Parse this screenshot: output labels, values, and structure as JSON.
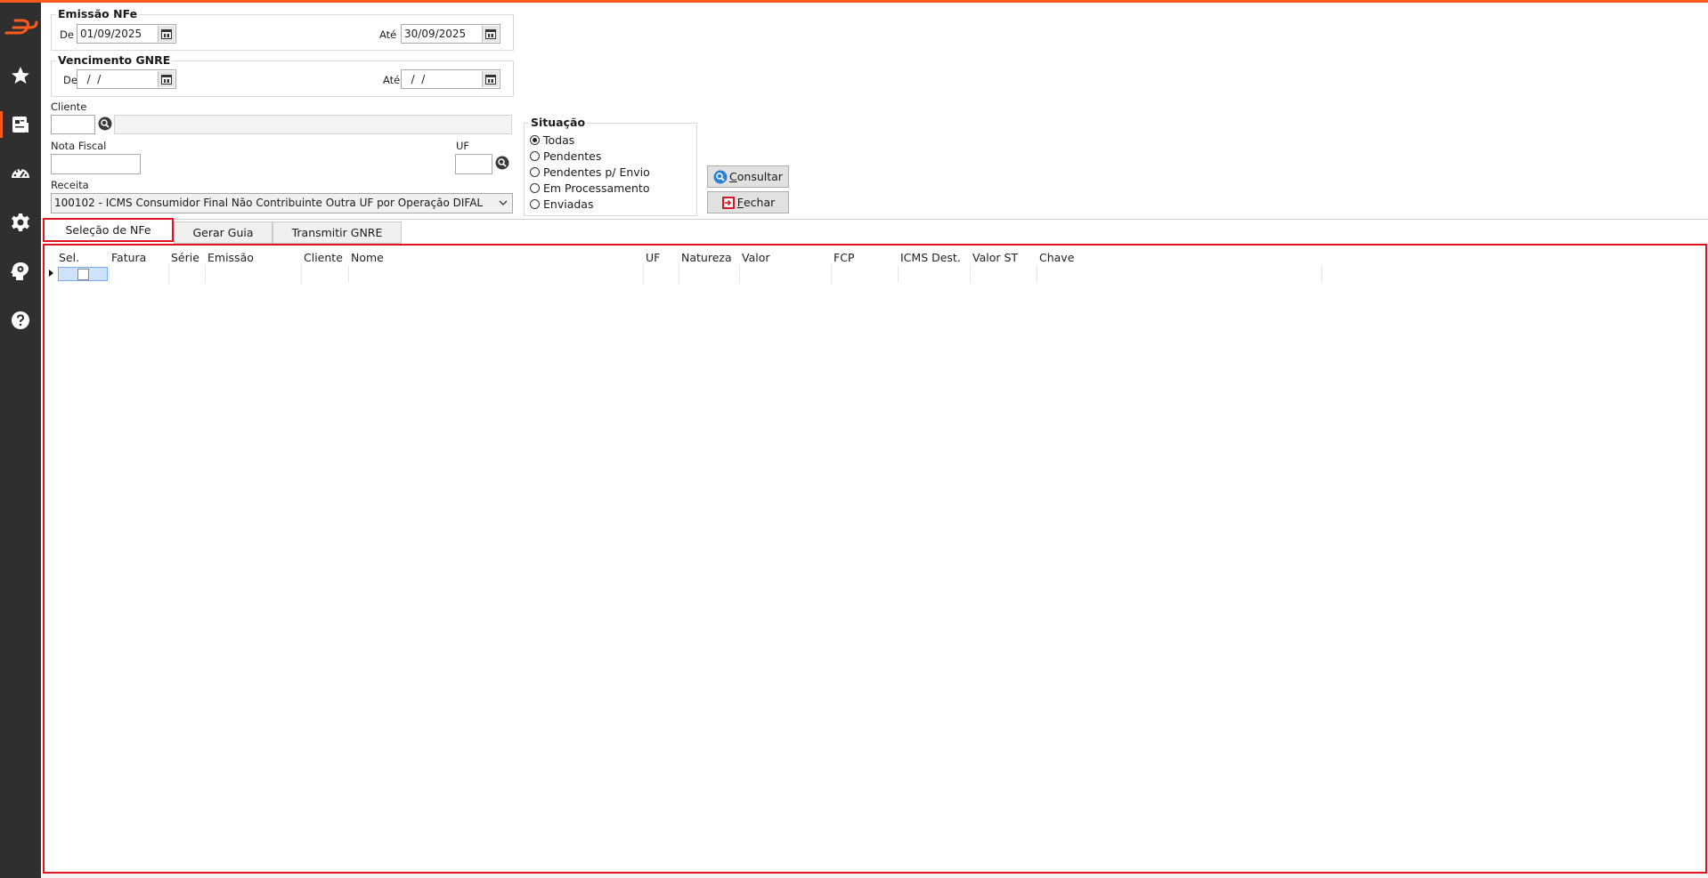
{
  "colors": {
    "accent": "#ff5a1f",
    "sidebar": "#2f2f2f",
    "highlight": "#e0141e"
  },
  "sidebar": {
    "logo": "logo-icon",
    "items": [
      {
        "icon": "star-icon"
      },
      {
        "icon": "document-list-icon",
        "active": true
      },
      {
        "icon": "dashboard-gauge-icon"
      },
      {
        "icon": "gear-icon"
      },
      {
        "icon": "head-gear-icon"
      },
      {
        "icon": "help-circle-icon"
      }
    ]
  },
  "emissao": {
    "legend": "Emissão NFe",
    "de_label": "De",
    "de_value": "01/09/2025",
    "ate_label": "Até",
    "ate_value": "30/09/2025"
  },
  "vencimento": {
    "legend": "Vencimento GNRE",
    "de_label": "De",
    "de_value": "  /  /",
    "ate_label": "Até",
    "ate_value": "  /  /"
  },
  "filters": {
    "cliente_label": "Cliente",
    "cliente_value": "",
    "cliente_nome": "",
    "nota_label": "Nota Fiscal",
    "nota_value": "",
    "uf_label": "UF",
    "uf_value": "",
    "receita_label": "Receita",
    "receita_value": "100102 - ICMS Consumidor Final Não Contribuinte Outra UF por Operação DIFAL"
  },
  "situacao": {
    "legend": "Situação",
    "options": [
      {
        "label": "Todas",
        "checked": true
      },
      {
        "label": "Pendentes",
        "checked": false
      },
      {
        "label": "Pendentes p/ Envio",
        "checked": false
      },
      {
        "label": "Em Processamento",
        "checked": false
      },
      {
        "label": "Enviadas",
        "checked": false
      }
    ]
  },
  "buttons": {
    "consultar_mn": "C",
    "consultar_rest": "onsultar",
    "fechar_mn": "F",
    "fechar_rest": "echar"
  },
  "tabs": [
    {
      "label": "Seleção de NFe",
      "active": true
    },
    {
      "label": "Gerar Guia",
      "active": false
    },
    {
      "label": "Transmitir GNRE",
      "active": false
    }
  ],
  "grid": {
    "columns": [
      "Sel.",
      "Fatura",
      "Série",
      "Emissão",
      "Cliente",
      "Nome",
      "UF",
      "Natureza",
      "Valor",
      "FCP",
      "ICMS Dest.",
      "Valor ST",
      "Chave"
    ],
    "rows": [
      {
        "selected": true,
        "checked": false
      }
    ]
  }
}
